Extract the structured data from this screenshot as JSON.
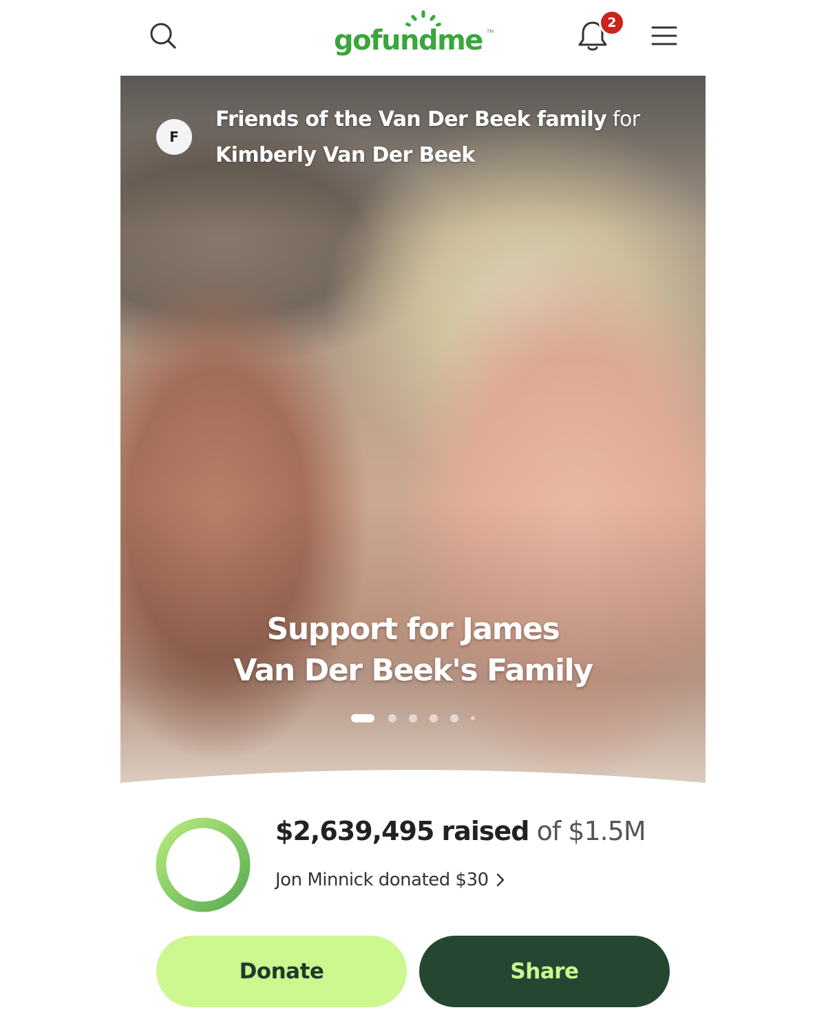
{
  "header": {
    "logo_text": "gofundme",
    "logo_tm": "TM",
    "notification_count": "2",
    "icons": [
      "search-icon",
      "bell-icon",
      "hamburger-menu-icon"
    ],
    "brand_color": "#3aa63d",
    "badge_color": "#c9251d"
  },
  "hero": {
    "avatar_initial": "F",
    "organizer": "Friends of the Van Der Beek family",
    "for_word": "for",
    "beneficiary": "Kimberly Van Der Beek",
    "title_line1": "Support for James",
    "title_line2": "Van Der Beek's Family",
    "carousel": {
      "total_dots": 6,
      "active_index": 0
    }
  },
  "progress": {
    "raised_amount": "$2,639,495",
    "raised_word": "raised",
    "goal_text": "of $1.5M",
    "ring_fill_fraction": 1.0,
    "ring_colors": [
      "#b6ec7c",
      "#5aab52"
    ],
    "recent_donation": "Jon Minnick donated $30"
  },
  "actions": {
    "donate_label": "Donate",
    "share_label": "Share",
    "donate_color": "#cdf78f",
    "share_color": "#254732"
  }
}
